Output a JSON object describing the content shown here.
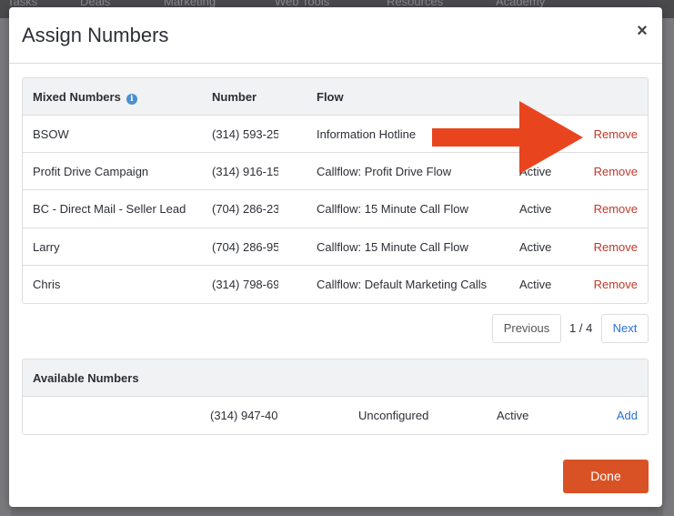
{
  "background": {
    "nav_items": [
      "Tasks",
      "Deals",
      "Marketing",
      "Web Tools",
      "Resources",
      "Academy"
    ]
  },
  "modal": {
    "title": "Assign Numbers",
    "close_icon": "close-icon"
  },
  "mixed_table": {
    "headers": {
      "name": "Mixed Numbers",
      "number": "Number",
      "flow": "Flow"
    },
    "info_icon": "info-icon",
    "rows": [
      {
        "name": "BSOW",
        "number": "(314) 593-25",
        "flow": "Information Hotline",
        "status": "",
        "action": "Remove"
      },
      {
        "name": "Profit Drive Campaign",
        "number": "(314) 916-15",
        "flow": "Callflow: Profit Drive Flow",
        "status": "Active",
        "action": "Remove"
      },
      {
        "name": "BC - Direct Mail - Seller Lead",
        "number": "(704) 286-23",
        "flow": "Callflow: 15 Minute Call Flow",
        "status": "Active",
        "action": "Remove"
      },
      {
        "name": "Larry",
        "number": "(704) 286-95",
        "flow": "Callflow: 15 Minute Call Flow",
        "status": "Active",
        "action": "Remove"
      },
      {
        "name": "Chris",
        "number": "(314) 798-69",
        "flow": "Callflow: Default Marketing Calls",
        "status": "Active",
        "action": "Remove"
      }
    ]
  },
  "pagination": {
    "previous": "Previous",
    "page": "1 / 4",
    "next": "Next"
  },
  "available_table": {
    "header": "Available Numbers",
    "rows": [
      {
        "number": "(314) 947-40",
        "flow": "Unconfigured",
        "status": "Active",
        "action": "Add"
      }
    ]
  },
  "done_label": "Done",
  "annotation": {
    "arrow_color": "#e8451f"
  }
}
